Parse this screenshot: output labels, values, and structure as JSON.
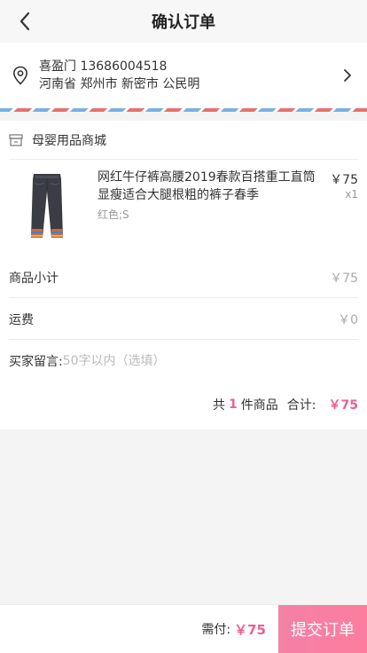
{
  "header": {
    "title": "确认订单",
    "back_icon": "chevron-left-icon"
  },
  "address": {
    "name_phone": "喜盈门 13686004518",
    "detail": "河南省 郑州市 新密市 公民明",
    "pin_icon": "location-pin-icon",
    "arrow_icon": "chevron-right-icon",
    "stripe_colors": [
      "#e8716f",
      "#7ab0e3"
    ]
  },
  "shop": {
    "name": "母婴用品商城",
    "icon": "store-icon"
  },
  "product": {
    "title": "网红牛仔裤高腰2019春款百搭重工直筒显瘦适合大腿根粗的裤子春季",
    "spec": "红色;S",
    "price": "￥75",
    "quantity": "x1"
  },
  "subtotal": {
    "label": "商品小计",
    "value": "￥75"
  },
  "shipping": {
    "label": "运费",
    "value": "￥0"
  },
  "note": {
    "label": "买家留言:",
    "placeholder": "50字以内（选填）",
    "value": ""
  },
  "summary": {
    "prefix": "共",
    "count": "1",
    "suffix": "件商品",
    "total_label": "合计:",
    "total": "￥75"
  },
  "footer": {
    "pay_label": "需付:",
    "pay_amount": "￥75",
    "submit_label": "提交订单"
  },
  "colors": {
    "accent": "#ef5e96",
    "button": "#f481a6"
  }
}
